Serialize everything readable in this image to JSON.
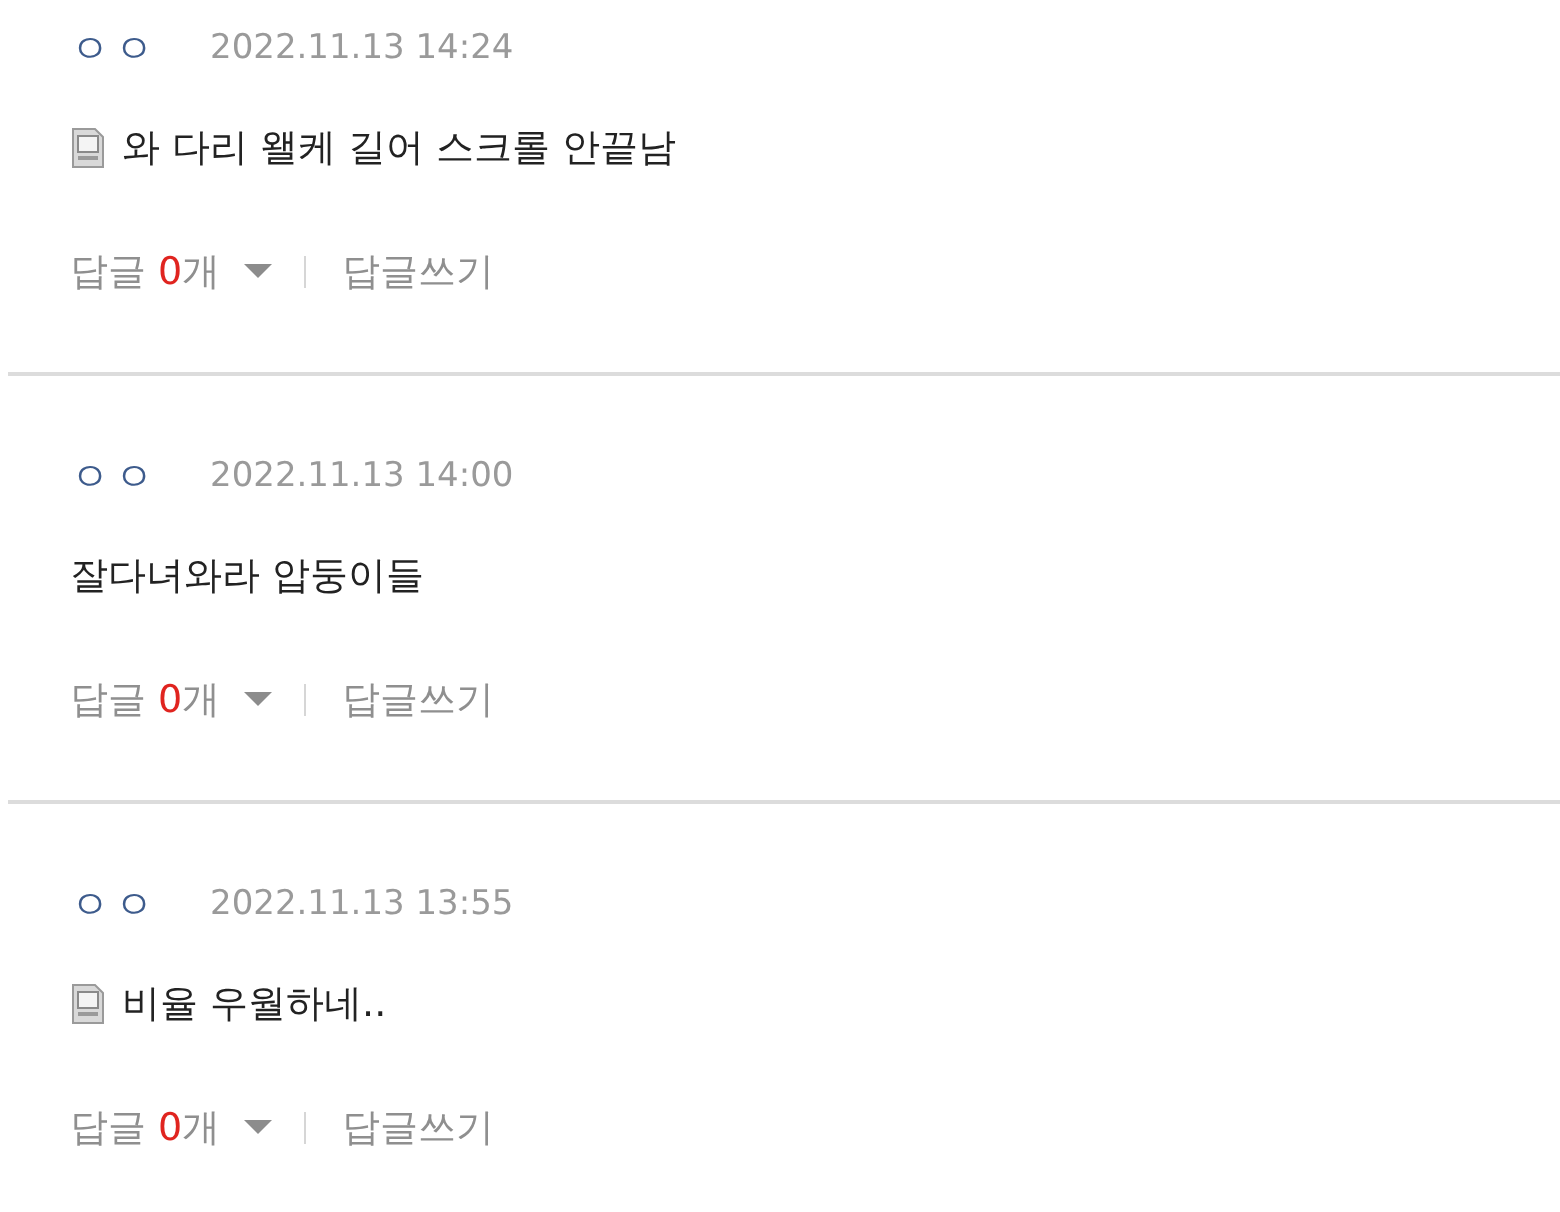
{
  "comments": [
    {
      "author": "ㅇㅇ",
      "date": "2022.11.13 14:24",
      "mobile": true,
      "text": "와 다리 왤케 길어 스크롤 안끝남",
      "reply_label": "답글",
      "reply_count": "0",
      "reply_unit": "개",
      "write_reply": "답글쓰기"
    },
    {
      "author": "ㅇㅇ",
      "date": "2022.11.13 14:00",
      "mobile": false,
      "text": "잘다녀와라 압둥이들",
      "reply_label": "답글",
      "reply_count": "0",
      "reply_unit": "개",
      "write_reply": "답글쓰기"
    },
    {
      "author": "ㅇㅇ",
      "date": "2022.11.13 13:55",
      "mobile": true,
      "text": "비율 우월하네..",
      "reply_label": "답글",
      "reply_count": "0",
      "reply_unit": "개",
      "write_reply": "답글쓰기"
    }
  ]
}
